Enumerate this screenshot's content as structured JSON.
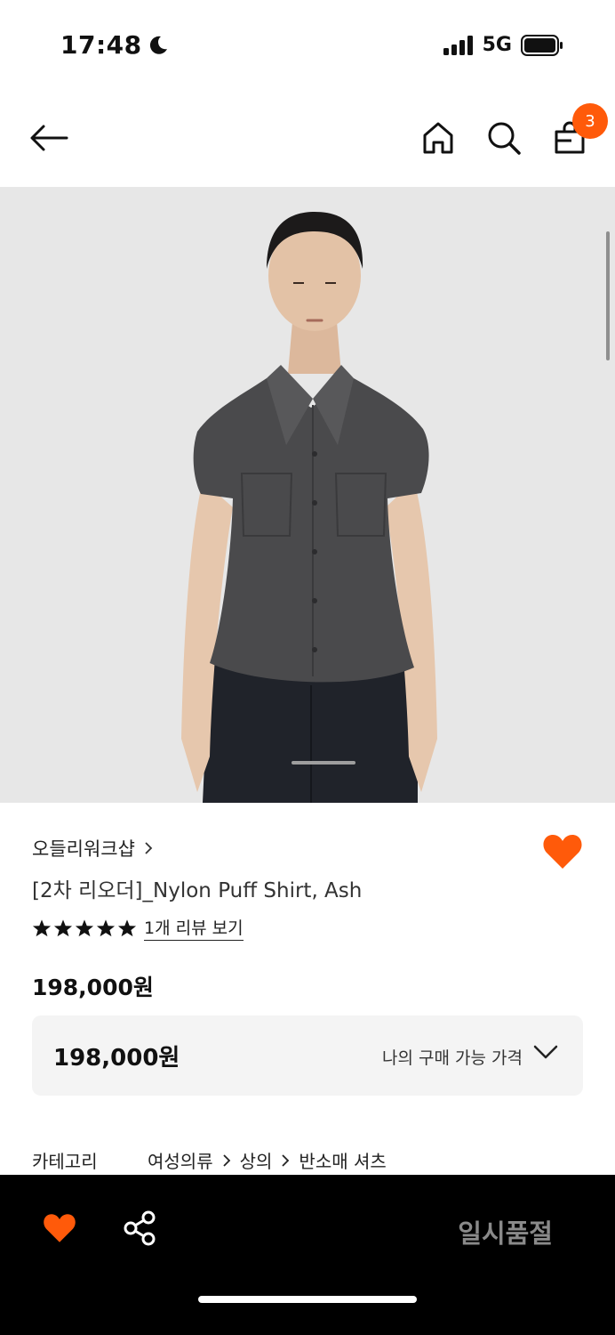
{
  "status_bar": {
    "time": "17:48",
    "network": "5G"
  },
  "nav": {
    "cart_count": "3"
  },
  "product": {
    "brand": "오들리워크샵",
    "name": "[2차 리오더]_Nylon Puff Shirt, Ash",
    "rating_stars": 5,
    "review_link": "1개 리뷰 보기",
    "price": "198,000원",
    "my_price_value": "198,000원",
    "my_price_label": "나의 구매 가능 가격",
    "category_label": "카테고리",
    "category_path": [
      "여성의류",
      "상의",
      "반소매 셔츠"
    ]
  },
  "bottom_bar": {
    "soldout_label": "일시품절"
  },
  "colors": {
    "accent": "#ff5a0a",
    "hero_bg": "#e7e7e7",
    "shirt": "#4a4a4c"
  }
}
